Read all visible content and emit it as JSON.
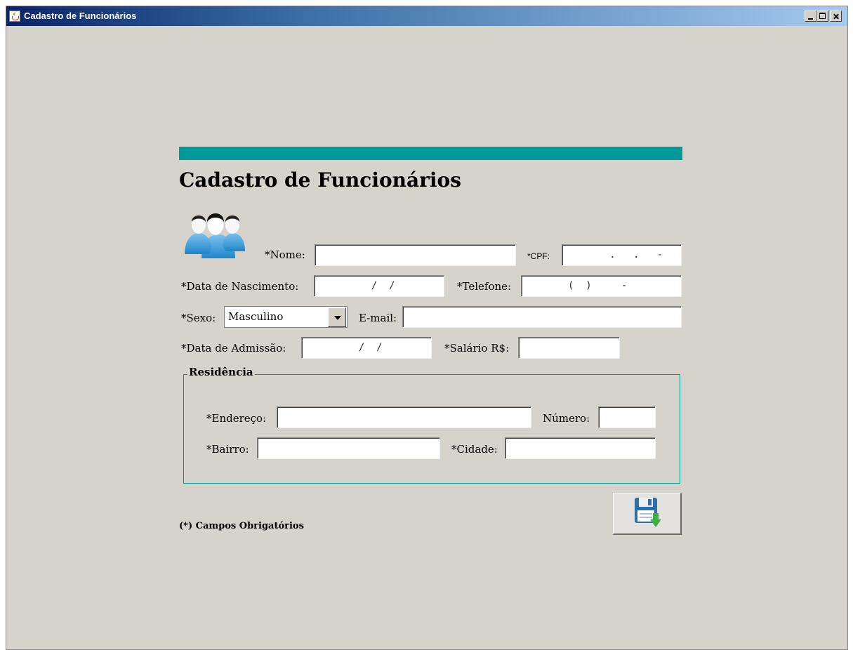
{
  "window": {
    "title": "Cadastro de Funcionários"
  },
  "form": {
    "title": "Cadastro de Funcionários",
    "nome_label": "*Nome:",
    "cpf_label": "*CPF:",
    "cpf_mask": "   .   .   -",
    "nascimento_label": "*Data de Nascimento:",
    "nascimento_mask": "  /  /",
    "telefone_label": "*Telefone:",
    "telefone_mask": "(  )     -",
    "sexo_label": "*Sexo:",
    "sexo_value": "Masculino",
    "email_label": "E-mail:",
    "admissao_label": "*Data de Admissão:",
    "admissao_mask": "  /  /",
    "salario_label": "*Salário R$:",
    "residencia_legend": "Residência",
    "endereco_label": "*Endereço:",
    "numero_label": "Número:",
    "bairro_label": "*Bairro:",
    "cidade_label": "*Cidade:",
    "footnote": "(*) Campos Obrigatórios"
  },
  "colors": {
    "accent": "#009999",
    "background": "#d6d3cd"
  },
  "icons": {
    "users": "users-icon",
    "save": "save-disk-icon"
  }
}
